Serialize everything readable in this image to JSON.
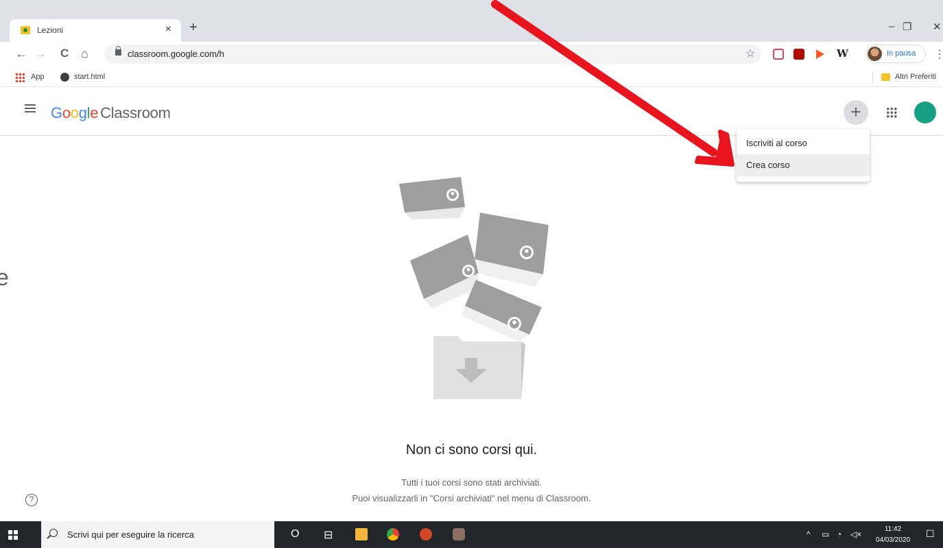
{
  "browser": {
    "tab_title": "Lezioni",
    "tab_close": "×",
    "new_tab": "+",
    "window_controls": {
      "minimize": "–",
      "restore": "❐",
      "close": "✕"
    },
    "nav": {
      "back": "←",
      "forward": "→",
      "reload": "C",
      "home": "⌂"
    },
    "url": "classroom.google.com/h",
    "star": "☆",
    "profile_label": "In pausa",
    "menu_glyph": "⋮",
    "bookmarks": [
      {
        "label": "App",
        "icon": "apps-grid-icon"
      },
      {
        "label": "start.html",
        "icon": "globe-icon"
      }
    ],
    "other_bookmarks": "Altri Preferiti",
    "extensions": [
      {
        "name": "pocket-icon",
        "color": "#ef4056"
      },
      {
        "name": "acrobat-icon",
        "color": "#b30b00"
      },
      {
        "name": "cast-icon",
        "color": "#ff5722"
      },
      {
        "name": "w-icon",
        "color": "#222222"
      }
    ]
  },
  "classroom": {
    "logo_letters": [
      "G",
      "o",
      "o",
      "g",
      "l",
      "e"
    ],
    "product": "Classroom",
    "plus": "+",
    "menu": [
      "Iscriviti al corso",
      "Crea corso"
    ],
    "empty": {
      "title": "Non ci sono corsi qui.",
      "line1": "Tutti i tuoi corsi sono stati archiviati.",
      "line2": "Puoi visualizzarli in \"Corsi archiviati\" nel menu di Classroom."
    },
    "help": "?",
    "cutoff_glyph": "e"
  },
  "taskbar": {
    "search_placeholder": "Scrivi qui per eseguire la ricerca",
    "cortana": "O",
    "task_view": "⊟",
    "time": "11:42",
    "date": "04/03/2020",
    "tray": {
      "chevron": "^",
      "battery": "▭",
      "wifi": "◔",
      "volume": "◁×",
      "notifications": "☐"
    }
  },
  "colors": {
    "arrow": "#e8141e",
    "accent_blue": "#1a73e8",
    "avatar": "#16a085"
  }
}
